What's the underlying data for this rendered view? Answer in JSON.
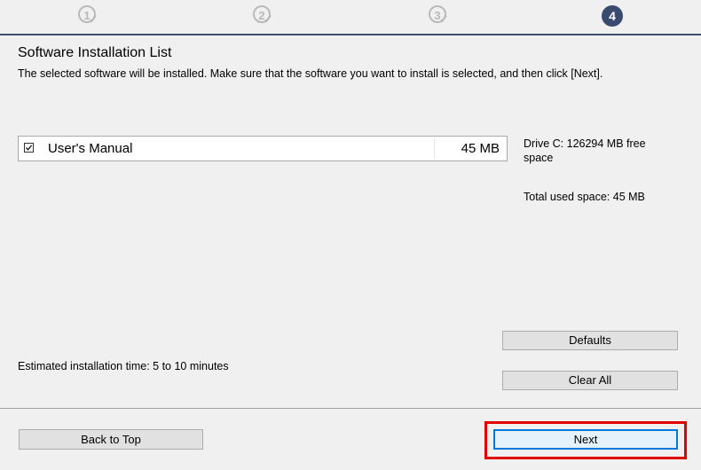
{
  "steps": [
    {
      "label": "1",
      "state": "done"
    },
    {
      "label": "2",
      "state": "done"
    },
    {
      "label": "3",
      "state": "done"
    },
    {
      "label": "4",
      "state": "active"
    }
  ],
  "page": {
    "title": "Software Installation List",
    "description": "The selected software will be installed. Make sure that the software you want to install is selected, and then click [Next]."
  },
  "software_list": [
    {
      "name": "User's Manual",
      "size": "45 MB",
      "checked": true
    }
  ],
  "disk": {
    "drive_info": "Drive C: 126294 MB free space",
    "total_used": "Total used space: 45 MB"
  },
  "estimate": "Estimated installation time: 5 to 10 minutes",
  "buttons": {
    "defaults": "Defaults",
    "clear_all": "Clear All",
    "back_to_top": "Back to Top",
    "next": "Next"
  },
  "colors": {
    "active_step": "#394a6e",
    "highlight": "#e00000",
    "focus": "#0078d7"
  }
}
